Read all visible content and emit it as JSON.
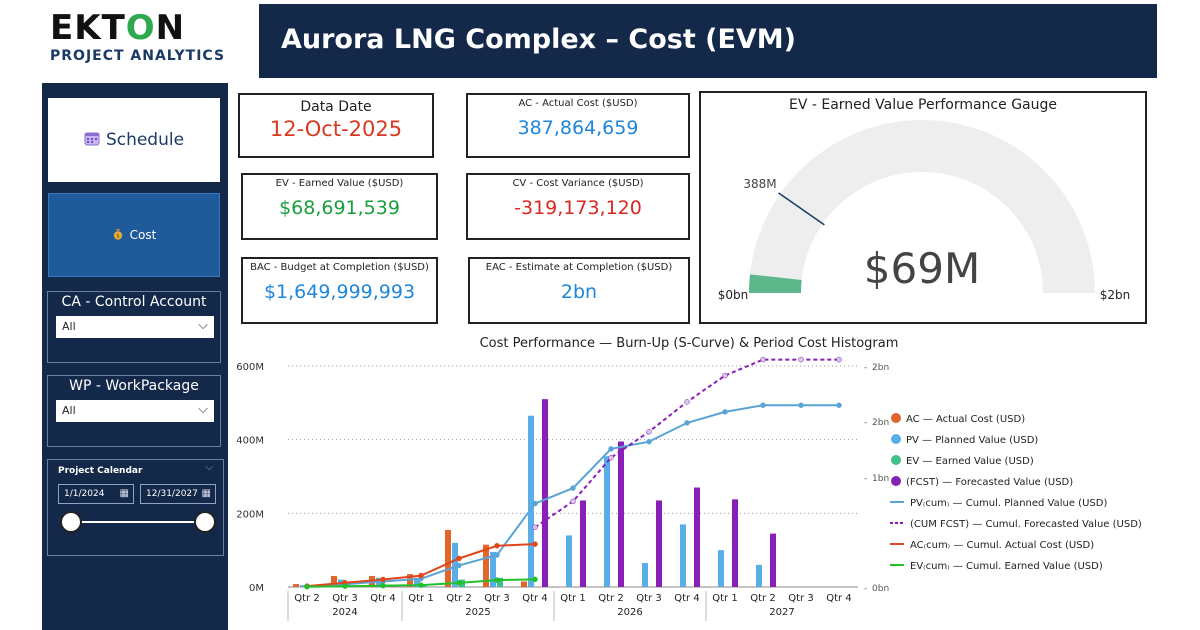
{
  "brand": {
    "logo_top": "EKTON",
    "logo_sub": "PROJECT ANALYTICS"
  },
  "header": {
    "title": "Aurora LNG Complex – Cost (EVM)"
  },
  "nav": {
    "schedule_label": "Schedule",
    "cost_label": "Cost",
    "schedule_icon": "calendar-icon",
    "cost_icon": "money-bag-icon"
  },
  "filters": {
    "control_account": {
      "label": "CA - Control Account",
      "value": "All"
    },
    "work_package": {
      "label": "WP - WorkPackage",
      "value": "All"
    },
    "calendar": {
      "label": "Project Calendar",
      "start": "1/1/2024",
      "end": "12/31/2027"
    }
  },
  "kpis": {
    "data_date": {
      "label": "Data Date",
      "value": "12-Oct-2025",
      "color": "#d93a1f"
    },
    "ac": {
      "label": "AC - Actual Cost ($USD)",
      "value": "387,864,659",
      "color": "#1f86d9"
    },
    "ev": {
      "label": "EV - Earned Value ($USD)",
      "value": "$68,691,539",
      "color": "#1a9f3f"
    },
    "cv": {
      "label": "CV - Cost Variance ($USD)",
      "value": "-319,173,120",
      "color": "#d9281f"
    },
    "bac": {
      "label": "BAC - Budget at Completion ($USD)",
      "value": "$1,649,999,993",
      "color": "#1f86d9"
    },
    "eac": {
      "label": "EAC - Estimate at Completion ($USD)",
      "value": "2bn",
      "color": "#1f86d9"
    }
  },
  "gauge": {
    "title": "EV - Earned Value Performance Gauge",
    "value_label": "$69M",
    "min_label": "$0bn",
    "max_label": "$2bn",
    "target_label": "388M",
    "value": 68.69,
    "target": 387.86,
    "min": 0,
    "max": 2000,
    "fill_color": "#5cb88a",
    "track_color": "#eeeeee"
  },
  "chart_data": {
    "type": "bar",
    "title": "Cost Performance — Burn-Up (S-Curve) & Period Cost Histogram",
    "categories": [
      "Qtr 2",
      "Qtr 3",
      "Qtr 4",
      "Qtr 1",
      "Qtr 2",
      "Qtr 3",
      "Qtr 4",
      "Qtr 1",
      "Qtr 2",
      "Qtr 3",
      "Qtr 4",
      "Qtr 1",
      "Qtr 2",
      "Qtr 3",
      "Qtr 4"
    ],
    "years": [
      {
        "label": "2024",
        "start": 0,
        "end": 2
      },
      {
        "label": "2025",
        "start": 3,
        "end": 6
      },
      {
        "label": "2026",
        "start": 7,
        "end": 10
      },
      {
        "label": "2027",
        "start": 11,
        "end": 14
      }
    ],
    "y_left": {
      "ticks": [
        "0M",
        "200M",
        "400M",
        "600M"
      ],
      "min": 0,
      "max": 600
    },
    "y_right": {
      "ticks": [
        "0bn",
        "1bn",
        "2bn",
        "2bn"
      ],
      "min": 0,
      "max": 2000
    },
    "grid": true,
    "legend_position": "right",
    "bars": [
      {
        "name": "AC — Actual Cost (USD)",
        "color": "#e0662b",
        "values": [
          8,
          30,
          30,
          35,
          155,
          115,
          15,
          null,
          null,
          null,
          null,
          null,
          null,
          null,
          null
        ]
      },
      {
        "name": "PV — Planned Value (USD)",
        "color": "#5aaee8",
        "values": [
          5,
          20,
          25,
          25,
          120,
          95,
          465,
          140,
          355,
          65,
          170,
          100,
          60,
          null,
          null
        ]
      },
      {
        "name": "EV — Earned Value (USD)",
        "color": "#3fbf8a",
        "values": [
          2,
          5,
          5,
          5,
          20,
          25,
          null,
          null,
          null,
          null,
          null,
          null,
          null,
          null,
          null
        ]
      },
      {
        "name": "(FCST) — Forecasted Value (USD)",
        "color": "#8a1fb8",
        "values": [
          null,
          null,
          null,
          null,
          null,
          null,
          510,
          235,
          395,
          235,
          270,
          238,
          145,
          null,
          null
        ]
      }
    ],
    "lines": [
      {
        "name": "PV₍cum₎ — Cumul. Planned Value (USD)",
        "color": "#5aa4d6",
        "dash": false,
        "values": [
          5,
          25,
          50,
          75,
          195,
          290,
          755,
          895,
          1250,
          1315,
          1485,
          1585,
          1645,
          1645,
          1645
        ]
      },
      {
        "name": "(CUM FCST) — Cumul. Forecasted Value (USD)",
        "color": "#8a1fb8",
        "dash": true,
        "values": [
          null,
          null,
          null,
          null,
          null,
          null,
          540,
          775,
          1170,
          1405,
          1675,
          1913,
          2058,
          2058,
          2058
        ]
      },
      {
        "name": "AC₍cum₎ — Cumul. Actual Cost (USD)",
        "color": "#e0461b",
        "dash": false,
        "values": [
          8,
          38,
          68,
          103,
          258,
          373,
          388,
          null,
          null,
          null,
          null,
          null,
          null,
          null,
          null
        ]
      },
      {
        "name": "EV₍cum₎ — Cumul. Earned Value (USD)",
        "color": "#22c02a",
        "dash": false,
        "values": [
          2,
          7,
          12,
          17,
          37,
          62,
          69,
          null,
          null,
          null,
          null,
          null,
          null,
          null,
          null
        ]
      }
    ]
  }
}
